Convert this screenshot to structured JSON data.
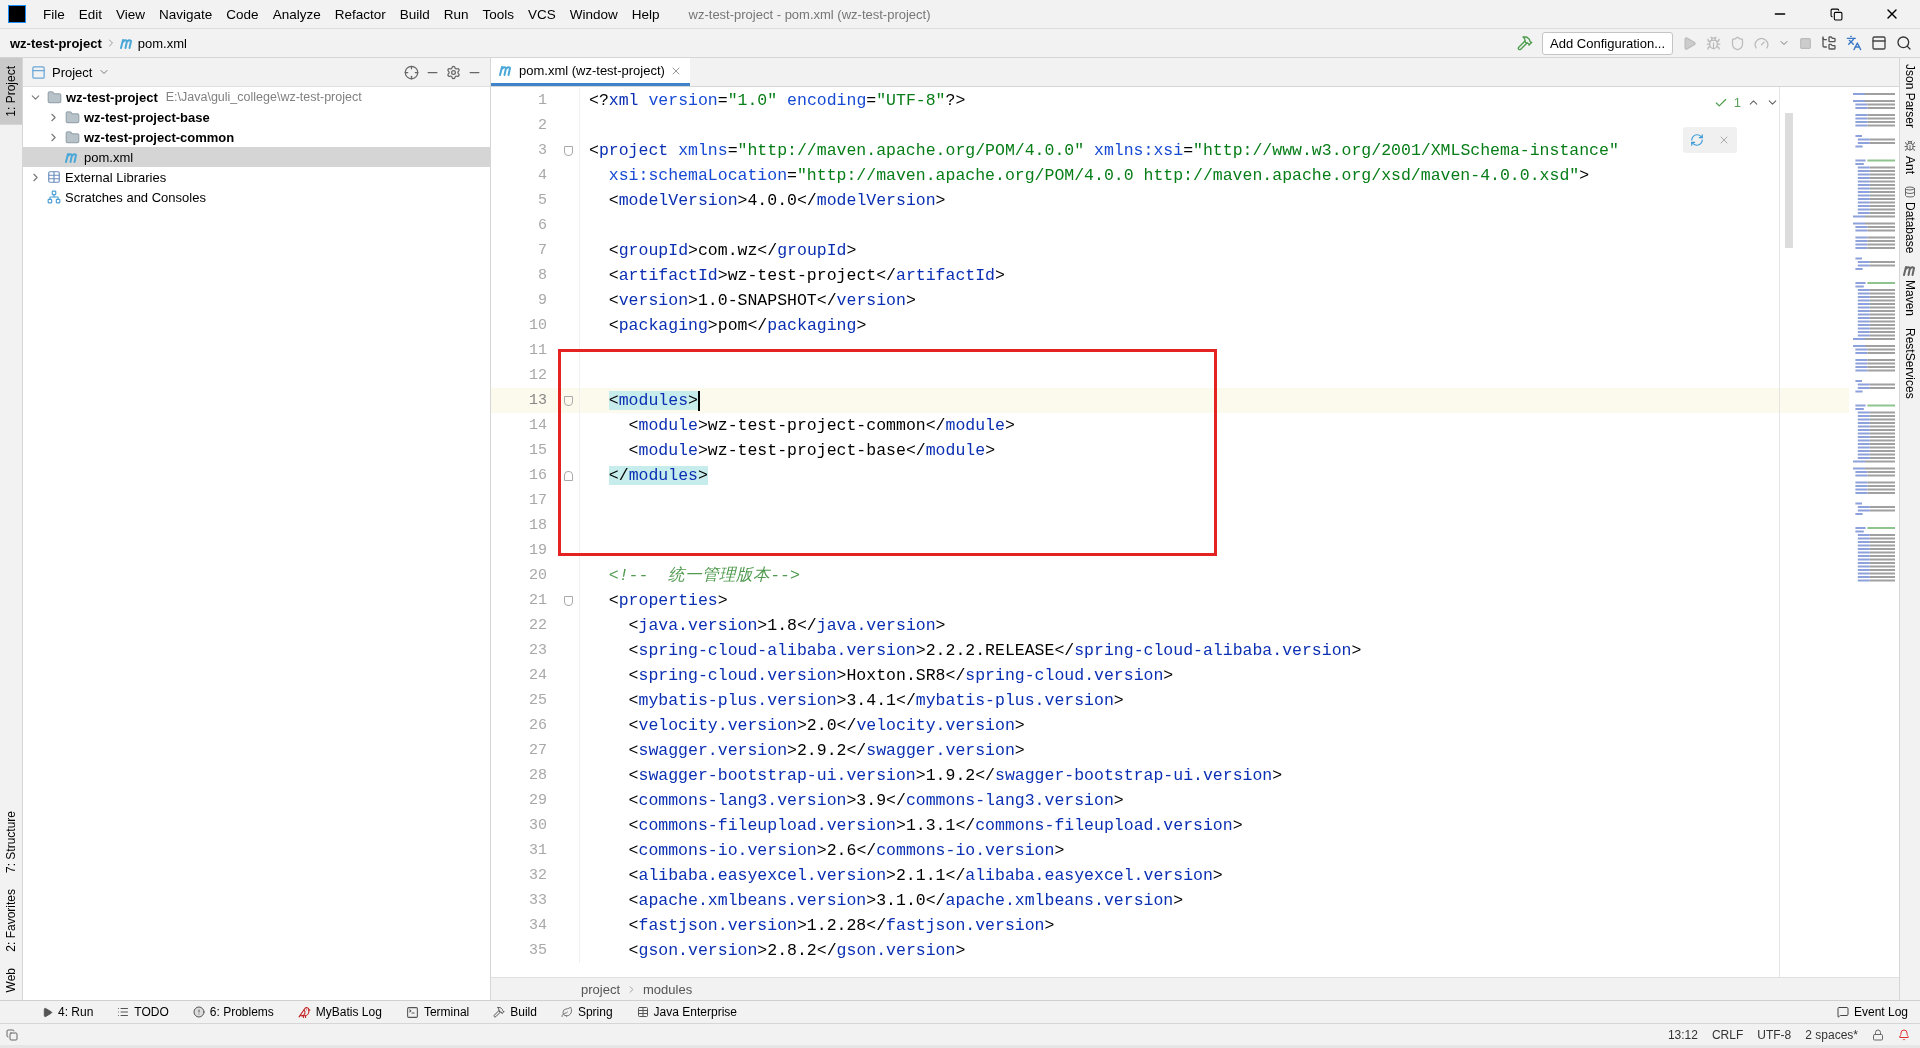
{
  "window": {
    "title": "wz-test-project - pom.xml (wz-test-project)"
  },
  "menu": [
    "File",
    "Edit",
    "View",
    "Navigate",
    "Code",
    "Analyze",
    "Refactor",
    "Build",
    "Run",
    "Tools",
    "VCS",
    "Window",
    "Help"
  ],
  "navigation_bar": {
    "project": "wz-test-project",
    "file": "pom.xml",
    "configuration": "Add Configuration..."
  },
  "left_strip_top": [
    {
      "label": "1: Project",
      "selected": true
    }
  ],
  "left_strip_bottom": [
    {
      "label": "7: Structure",
      "selected": false
    },
    {
      "label": "2: Favorites",
      "selected": false
    },
    {
      "label": "Web",
      "selected": false
    }
  ],
  "project_panel": {
    "title": "Project",
    "tree": [
      {
        "label": "wz-test-project",
        "path": "E:\\Java\\guli_college\\wz-test-project",
        "kind": "module",
        "expanded": true,
        "selected": false,
        "children": [
          {
            "label": "wz-test-project-base",
            "kind": "module",
            "expanded": false,
            "selected": false
          },
          {
            "label": "wz-test-project-common",
            "kind": "module",
            "expanded": false,
            "selected": false
          },
          {
            "label": "pom.xml",
            "kind": "maven",
            "selected": true
          }
        ]
      },
      {
        "label": "External Libraries",
        "kind": "libraries",
        "expanded": false,
        "selected": false
      },
      {
        "label": "Scratches and Consoles",
        "kind": "scratches",
        "selected": false
      }
    ]
  },
  "editor": {
    "tabs": [
      {
        "label": "pom.xml (wz-test-project)",
        "selected": true
      }
    ],
    "inspection_count": "1",
    "lines": [
      {
        "number": "1",
        "code": "<?xml version=\"1.0\" encoding=\"UTF-8\"?>"
      },
      {
        "number": "2"
      },
      {
        "number": "3",
        "code": "<project xmlns=\"http://maven.apache.org/POM/4.0.0\" xmlns:xsi=\"http://www.w3.org/2001/XMLSchema-instance\"",
        "fold_open": true
      },
      {
        "number": "4",
        "code": "  xsi:schemaLocation=\"http://maven.apache.org/POM/4.0.0 http://maven.apache.org/xsd/maven-4.0.0.xsd\">"
      },
      {
        "number": "5",
        "code": "  <modelVersion>4.0.0</modelVersion>"
      },
      {
        "number": "6"
      },
      {
        "number": "7",
        "code": "  <groupId>com.wz</groupId>"
      },
      {
        "number": "8",
        "code": "  <artifactId>wz-test-project</artifactId>"
      },
      {
        "number": "9",
        "code": "  <version>1.0-SNAPSHOT</version>"
      },
      {
        "number": "10",
        "code": "  <packaging>pom</packaging>"
      },
      {
        "number": "11"
      },
      {
        "number": "12"
      },
      {
        "number": "13",
        "code": "  <modules>",
        "current": true,
        "matched": true,
        "fold_open": true
      },
      {
        "number": "14",
        "code": "    <module>wz-test-project-common</module>"
      },
      {
        "number": "15",
        "code": "    <module>wz-test-project-base</module>"
      },
      {
        "number": "16",
        "code": "  </modules>",
        "matched": true,
        "fold_close": true
      },
      {
        "number": "17"
      },
      {
        "number": "18"
      },
      {
        "number": "19"
      },
      {
        "number": "20",
        "code": "  <!--  统一管理版本-->"
      },
      {
        "number": "21",
        "code": "  <properties>",
        "fold_open": true
      },
      {
        "number": "22",
        "code": "    <java.version>1.8</java.version>"
      },
      {
        "number": "23",
        "code": "    <spring-cloud-alibaba.version>2.2.2.RELEASE</spring-cloud-alibaba.version>"
      },
      {
        "number": "24",
        "code": "    <spring-cloud.version>Hoxton.SR8</spring-cloud.version>"
      },
      {
        "number": "25",
        "code": "    <mybatis-plus.version>3.4.1</mybatis-plus.version>"
      },
      {
        "number": "26",
        "code": "    <velocity.version>2.0</velocity.version>"
      },
      {
        "number": "27",
        "code": "    <swagger.version>2.9.2</swagger.version>"
      },
      {
        "number": "28",
        "code": "    <swagger-bootstrap-ui.version>1.9.2</swagger-bootstrap-ui.version>"
      },
      {
        "number": "29",
        "code": "    <commons-lang3.version>3.9</commons-lang3.version>"
      },
      {
        "number": "30",
        "code": "    <commons-fileupload.version>1.3.1</commons-fileupload.version>"
      },
      {
        "number": "31",
        "code": "    <commons-io.version>2.6</commons-io.version>"
      },
      {
        "number": "32",
        "code": "    <alibaba.easyexcel.version>2.1.1</alibaba.easyexcel.version>"
      },
      {
        "number": "33",
        "code": "    <apache.xmlbeans.version>3.1.0</apache.xmlbeans.version>"
      },
      {
        "number": "34",
        "code": "    <fastjson.version>1.2.28</fastjson.version>"
      },
      {
        "number": "35",
        "code": "    <gson.version>2.8.2</gson.version>"
      }
    ],
    "breadcrumbs": [
      "project",
      "modules"
    ]
  },
  "right_strip": [
    "Json Parser",
    "Ant",
    "Database",
    "Maven",
    "RestServices"
  ],
  "tool_tabs": [
    {
      "label": "4: Run",
      "kind": "run"
    },
    {
      "label": "TODO",
      "kind": "todo"
    },
    {
      "label": "6: Problems",
      "kind": "problems"
    },
    {
      "label": "MyBatis Log",
      "kind": "bird"
    },
    {
      "label": "Terminal",
      "kind": "terminal"
    },
    {
      "label": "Build",
      "kind": "build"
    },
    {
      "label": "Spring",
      "kind": "spring"
    },
    {
      "label": "Java Enterprise",
      "kind": "enterprise"
    }
  ],
  "event_log": "Event Log",
  "status_bar": {
    "position": "13:12",
    "line_separator": "CRLF",
    "encoding": "UTF-8",
    "indent": "2 spaces*"
  }
}
